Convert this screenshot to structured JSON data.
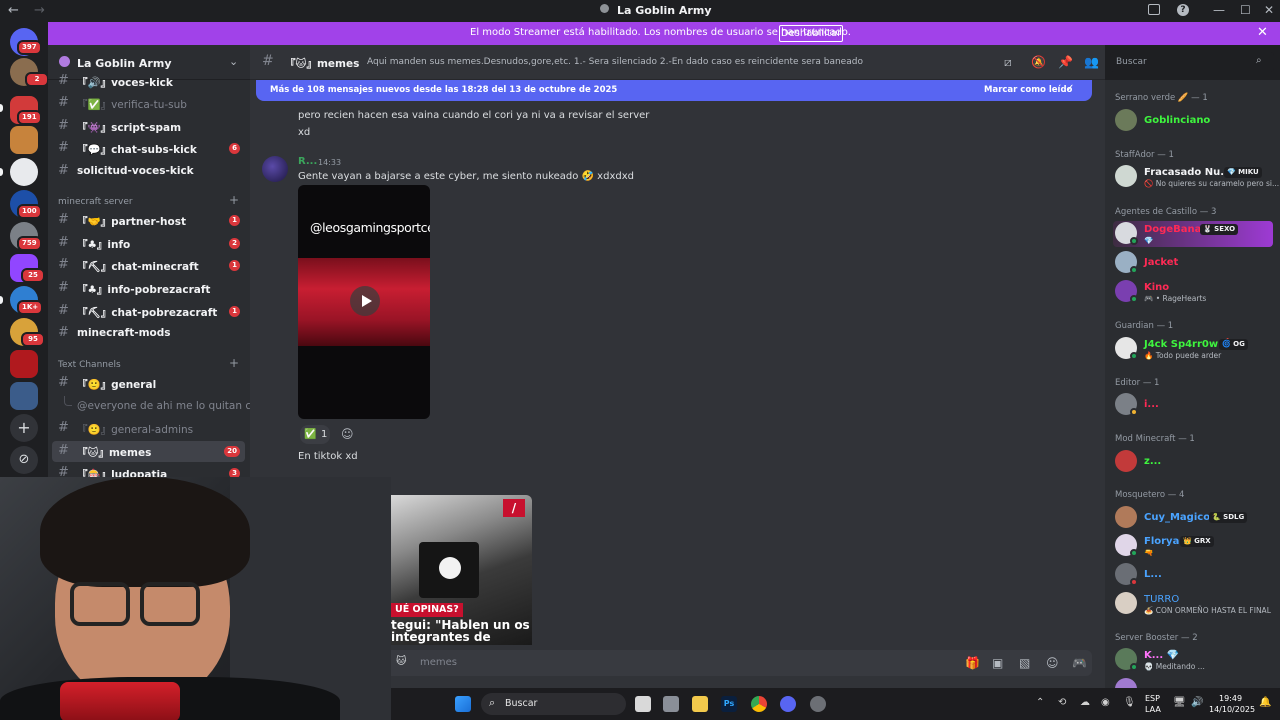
{
  "titlebar": {
    "title": "La Goblin Army",
    "back": "←",
    "forward": "→",
    "min": "—",
    "max": "☐",
    "close": "✕"
  },
  "banner": {
    "text": "El modo Streamer está habilitado. Los nombres de usuario se han truncado.",
    "button": "Deshabilitar"
  },
  "rail": {
    "badges": [
      "397",
      "2",
      "191",
      "759",
      "25",
      "1K+",
      "95",
      "100"
    ]
  },
  "server": {
    "name": "La Goblin Army"
  },
  "channels": [
    {
      "label": "『🔊』voces-kick",
      "bold": true
    },
    {
      "label": "『✅』verifica-tu-sub",
      "bold": false
    },
    {
      "label": "『👾』script-spam",
      "bold": true
    },
    {
      "label": "『💬』chat-subs-kick",
      "bold": true,
      "count": "6"
    },
    {
      "label": "solicitud-voces-kick",
      "bold": true
    }
  ],
  "minecraft_category": "minecraft server",
  "minecraft_channels": [
    {
      "label": "『🤝』partner-host",
      "count": "1"
    },
    {
      "label": "『♣』info",
      "count": "2"
    },
    {
      "label": "『⛏』chat-minecraft",
      "count": "1"
    },
    {
      "label": "『♣』info-pobrezacraft"
    },
    {
      "label": "『⛏』chat-pobrezacraft",
      "count": "1"
    },
    {
      "label": "minecraft-mods"
    }
  ],
  "text_category": "Text Channels",
  "text_channels": {
    "general": "『🙂』general",
    "thread": "@everyone de ahi me lo quitan ch...",
    "general_admins": "『🙂』general-admins",
    "memes": "『🐱』memes",
    "memes_count": "20",
    "ludopatia": "『🎰』ludopatia",
    "ludopatia_count": "3"
  },
  "header": {
    "channel": "『🐱』memes",
    "topic": "Aqui manden sus memes.Desnudos,gore,etc. 1.- Sera silenciado 2.-En dado caso es reincidente sera baneado"
  },
  "search": {
    "placeholder": "Buscar"
  },
  "newbar": {
    "text": "Más de 108 mensajes nuevos desde las 18:28 del 13 de octubre de 2025",
    "mark": "Marcar como leído"
  },
  "messages": {
    "line1": "pero recien hacen esa vaina cuando el cori ya ni va a revisar el server",
    "line2": "xd",
    "author": "R...",
    "time": "14:33",
    "text": "Gente vayan a bajarse a este cyber, me siento nukeado 🤣 xdxdxd",
    "video_handle": "@leosgamingsportcenter",
    "reaction_emoji": "✅",
    "reaction_count": "1",
    "reaction_add": "☺",
    "text2": "En tiktok xd",
    "thumb_q": "UÉ OPINAS?",
    "thumb_quote": "tegui: \"Hablen un os integrantes de"
  },
  "composer": {
    "placeholder": "memes",
    "prefix": "🐱"
  },
  "members": [
    {
      "group": "Serrano verde 🥖 — 1",
      "items": [
        {
          "name": "Goblinciano",
          "color": "#3ef53e"
        }
      ]
    },
    {
      "group": "StaffAdor — 1",
      "items": [
        {
          "name": "Fracasado Nu...",
          "color": "#f2f3f5",
          "tag": "💎 MIKU",
          "sub": "🚫 No quieres su caramelo pero si..."
        }
      ]
    },
    {
      "group": "Agentes de Castillo — 3",
      "items": [
        {
          "name": "DogeBanane",
          "color": "#ff2a55",
          "tag": "🐰 SEXO",
          "sub": "💎",
          "highlight": true
        },
        {
          "name": "Jacket",
          "color": "#ff2a55"
        },
        {
          "name": "Kino",
          "color": "#ff2a55",
          "sub": "🎮 • RageHearts"
        }
      ]
    },
    {
      "group": "Guardian — 1",
      "items": [
        {
          "name": "J4ck Sp4rr0w 🔥",
          "color": "#3ef53e",
          "tag": "🌀 OG",
          "sub": "🔥 Todo puede arder"
        }
      ]
    },
    {
      "group": "Editor — 1",
      "items": [
        {
          "name": "i...",
          "color": "#ff2a55"
        }
      ]
    },
    {
      "group": "Mod Minecraft — 1",
      "items": [
        {
          "name": "z...",
          "color": "#3ef53e"
        }
      ]
    },
    {
      "group": "Mosquetero — 4",
      "items": [
        {
          "name": "Cuy_Magico",
          "color": "#4aa3ff",
          "tag": "🐍 SDLG"
        },
        {
          "name": "Floryan",
          "color": "#4aa3ff",
          "tag": "👑 GRX",
          "sub": "🔫"
        },
        {
          "name": "L...",
          "color": "#4aa3ff"
        },
        {
          "name": "TURRO",
          "color": "#4aa3ff",
          "sub": "🍝 CON ORMEÑO HASTA EL FINAL"
        }
      ]
    },
    {
      "group": "Server Booster — 2",
      "items": [
        {
          "name": "K... 💎",
          "color": "#ff73fa",
          "sub": "💀 Meditando ..."
        }
      ]
    }
  ],
  "taskbar": {
    "search": "Buscar",
    "lang1": "ESP",
    "lang2": "LAA",
    "time": "19:49",
    "date": "14/10/2025"
  }
}
